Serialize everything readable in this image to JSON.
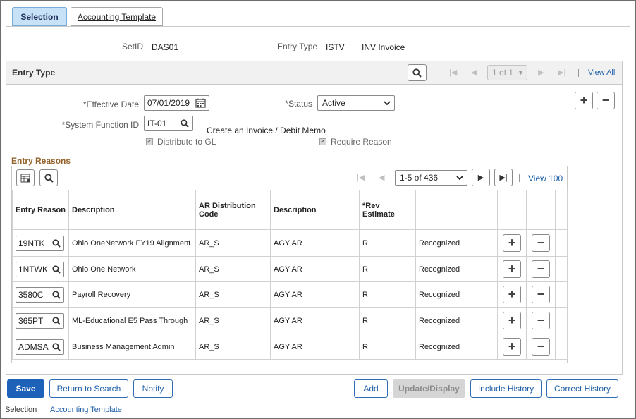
{
  "tabs": [
    {
      "label": "Selection",
      "active": true
    },
    {
      "label": "Accounting Template",
      "active": false
    }
  ],
  "header": {
    "setid_label": "SetID",
    "setid_value": "DAS01",
    "entry_type_label": "Entry Type",
    "entry_type_value": "ISTV",
    "entry_type_desc": "INV Invoice"
  },
  "panel": {
    "title": "Entry Type",
    "nav_position": "1 of 1",
    "view_all": "View All"
  },
  "form": {
    "effective_date_label": "*Effective Date",
    "effective_date_value": "07/01/2019",
    "status_label": "*Status",
    "status_value": "Active",
    "system_function_label": "*System Function ID",
    "system_function_value": "IT-01",
    "system_function_desc": "Create an Invoice / Debit Memo",
    "distribute_label": "Distribute to GL",
    "require_reason_label": "Require Reason"
  },
  "entry_reasons": {
    "title": "Entry Reasons",
    "nav_position": "1-5 of 436",
    "view_100": "View 100",
    "columns": [
      "Entry Reason",
      "Description",
      "AR Distribution Code",
      "Description",
      "*Rev Estimate",
      ""
    ],
    "rows": [
      {
        "reason": "19NTK",
        "description": "Ohio OneNetwork FY19 Alignment",
        "dist_code": "AR_S",
        "dist_desc": "AGY AR",
        "rev": "R",
        "rev_desc": "Recognized"
      },
      {
        "reason": "1NTWK",
        "description": "Ohio One Network",
        "dist_code": "AR_S",
        "dist_desc": "AGY AR",
        "rev": "R",
        "rev_desc": "Recognized"
      },
      {
        "reason": "3580C",
        "description": "Payroll Recovery",
        "dist_code": "AR_S",
        "dist_desc": "AGY AR",
        "rev": "R",
        "rev_desc": "Recognized"
      },
      {
        "reason": "365PT",
        "description": "ML-Educational E5 Pass Through",
        "dist_code": "AR_S",
        "dist_desc": "AGY AR",
        "rev": "R",
        "rev_desc": "Recognized"
      },
      {
        "reason": "ADMSA",
        "description": "Business Management Admin",
        "dist_code": "AR_S",
        "dist_desc": "AGY AR",
        "rev": "R",
        "rev_desc": "Recognized"
      }
    ]
  },
  "buttons": {
    "save": "Save",
    "return_to_search": "Return to Search",
    "notify": "Notify",
    "add": "Add",
    "update_display": "Update/Display",
    "include_history": "Include History",
    "correct_history": "Correct History"
  },
  "footer": {
    "selection": "Selection",
    "accounting_template": "Accounting Template"
  },
  "colors": {
    "accent": "#1d62b8",
    "tab_active": "#c7e1f6",
    "section_title": "#94622a"
  }
}
